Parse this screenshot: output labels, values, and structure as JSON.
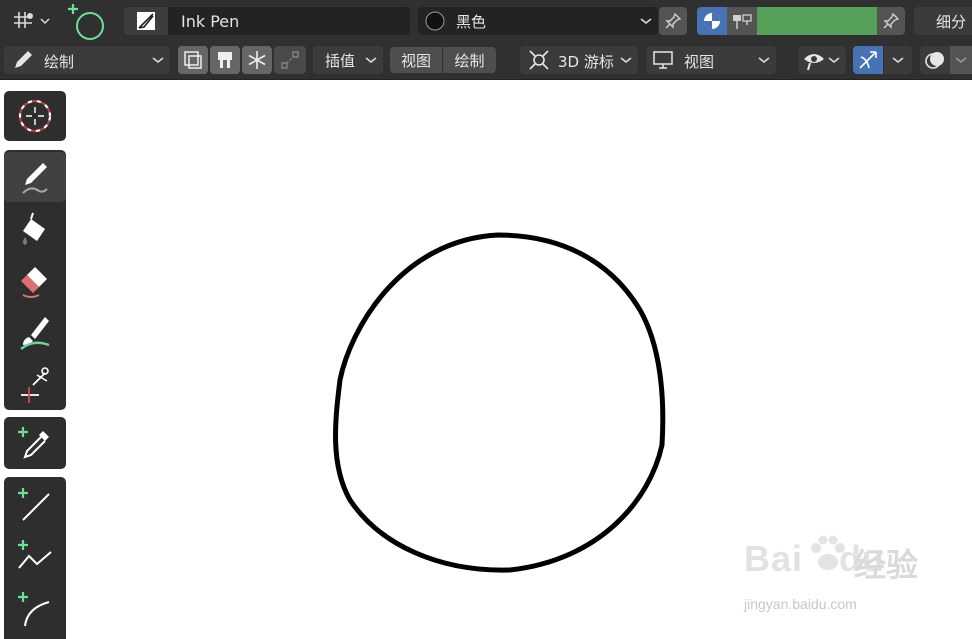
{
  "header": {
    "brush_name": "Ink Pen",
    "material_name": "黑色",
    "right_label": "细分",
    "mode_label": "绘制",
    "interpolate_label": "插值",
    "view_label": "视图",
    "draw_label": "绘制",
    "cursor_label": "3D 游标",
    "view_select_label": "视图",
    "colors": {
      "header_bg": "#303030",
      "field_bg": "#232323",
      "button_bg": "#545454",
      "active_blue": "#4772b3",
      "green_swatch": "#57a05a"
    }
  },
  "toolbar": {
    "tools": [
      {
        "name": "cursor",
        "icon": "cursor-icon"
      },
      {
        "name": "draw",
        "icon": "pen-icon"
      },
      {
        "name": "fill",
        "icon": "fill-bucket-icon"
      },
      {
        "name": "erase",
        "icon": "eraser-icon"
      },
      {
        "name": "tint",
        "icon": "tint-brush-icon"
      },
      {
        "name": "cutter",
        "icon": "scissors-icon"
      },
      {
        "name": "eyedropper",
        "icon": "eyedropper-icon"
      },
      {
        "name": "line",
        "icon": "line-icon"
      },
      {
        "name": "polyline",
        "icon": "polyline-icon"
      },
      {
        "name": "arc",
        "icon": "arc-icon"
      }
    ]
  },
  "watermark": {
    "logo_text": "Bai",
    "logo_text2": "du",
    "brand_text": "经验",
    "url_text": "jingyan.baidu.com"
  }
}
